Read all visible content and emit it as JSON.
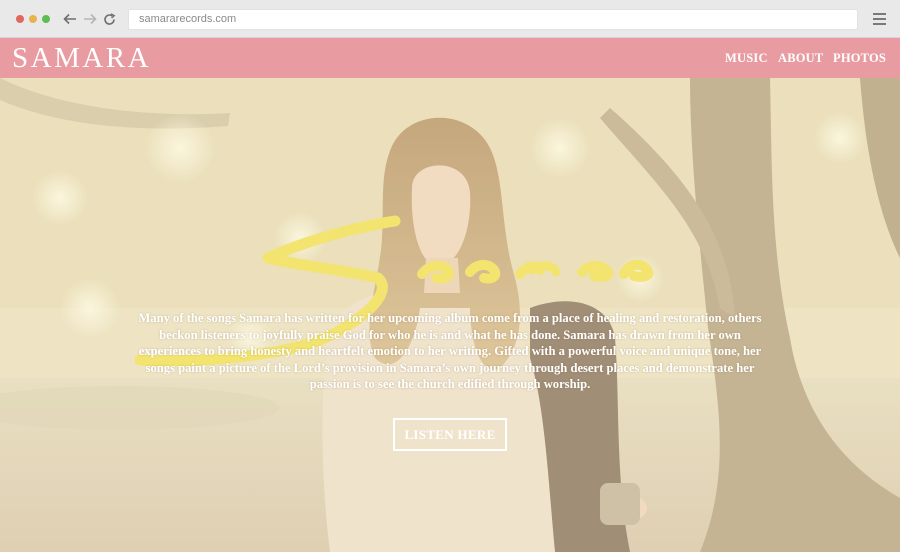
{
  "browser": {
    "url": "samararecords.com"
  },
  "header": {
    "logo": "SAMARA",
    "nav": [
      {
        "label": "MUSIC"
      },
      {
        "label": "ABOUT"
      },
      {
        "label": "PHOTOS"
      }
    ],
    "background_color": "#e89ca2"
  },
  "hero": {
    "signature_icon": "samara-signature",
    "signature_color": "#f2e46f",
    "paragraph": "Many of the songs Samara has written for her upcoming album come from a place of healing and restoration, others beckon listeners to joyfully praise God for who he is and what he has done. Samara has drawn from her own experiences to bring honesty and heartfelt emotion to her writing. Gifted with a powerful voice and unique tone, her songs paint a picture of the Lord’s provision in Samara’s own journey through desert places and demonstrate her passion is to see the church edified through worship.",
    "cta_label": "LISTEN HERE"
  }
}
